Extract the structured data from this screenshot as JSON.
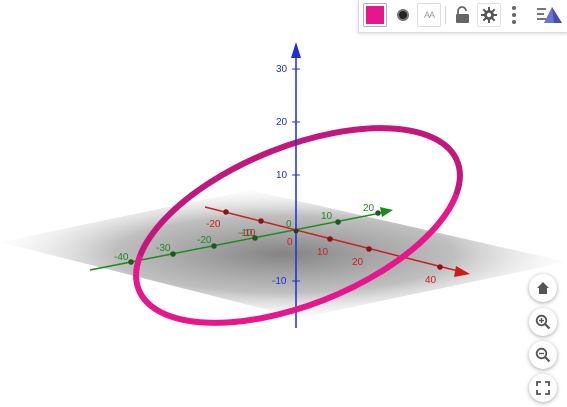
{
  "toolbar": {
    "color_label": "Color",
    "point_style_label": "Point style",
    "label_style_text": "AA",
    "lock_label": "Lock",
    "settings_label": "Settings",
    "more_label": "More",
    "view_label": "Graphics 3D style"
  },
  "colors": {
    "selected_object": "#e6168c",
    "x_axis": "#cc1d1d",
    "y_axis": "#1e8a1e",
    "z_axis": "#1a2fd6"
  },
  "axes": {
    "x_ticks": [
      "-20",
      "-10",
      "0",
      "10",
      "20",
      "40"
    ],
    "y_ticks": [
      "-40",
      "-30",
      "-20",
      "-10",
      "0",
      "10",
      "20"
    ],
    "z_ticks": [
      "-10",
      "10",
      "20",
      "30"
    ]
  },
  "view_controls": {
    "home": "Standard view",
    "zoom_in": "Zoom in",
    "zoom_out": "Zoom out",
    "fullscreen": "Fullscreen"
  }
}
